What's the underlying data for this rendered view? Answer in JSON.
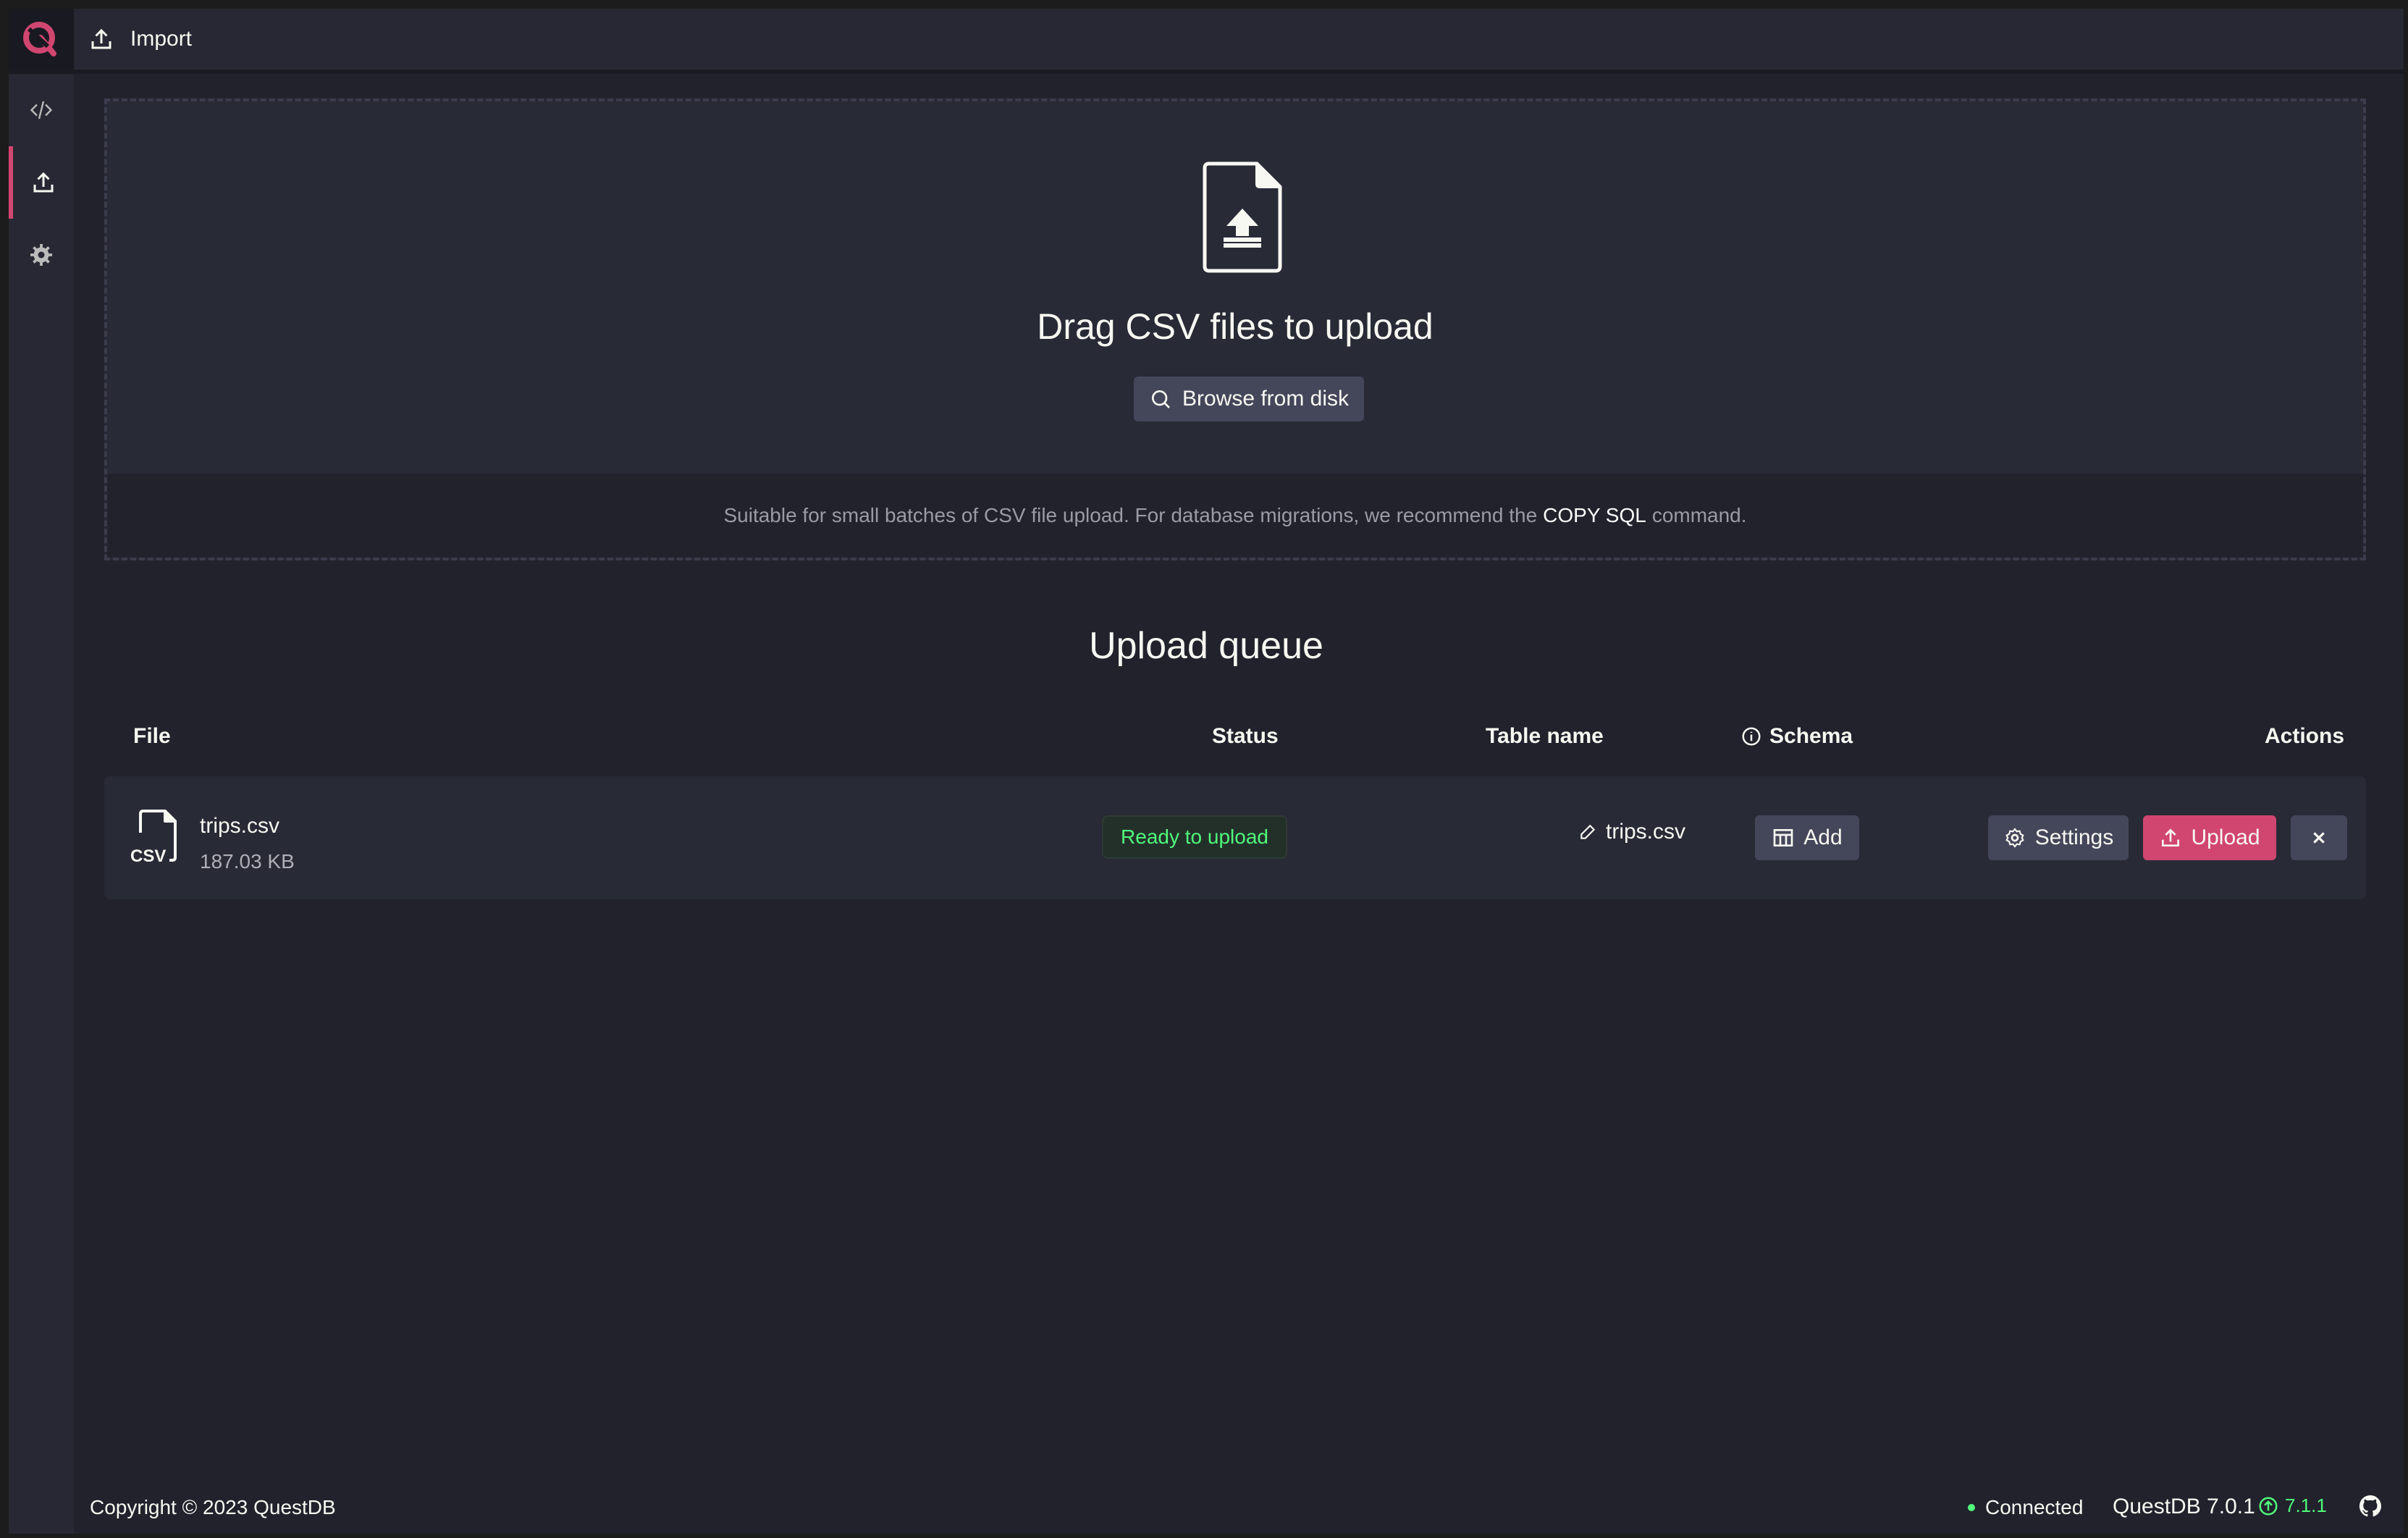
{
  "header": {
    "title": "Import"
  },
  "sidebar": {
    "items": [
      {
        "name": "code",
        "icon": "code-icon"
      },
      {
        "name": "import",
        "icon": "upload-icon",
        "active": true
      },
      {
        "name": "settings",
        "icon": "gear-icon"
      }
    ]
  },
  "dropzone": {
    "heading": "Drag CSV files to upload",
    "browse_label": "Browse from disk",
    "note_prefix": "Suitable for small batches of CSV file upload. For database migrations, we recommend the",
    "note_link": "COPY SQL",
    "note_suffix": "command."
  },
  "queue": {
    "title": "Upload queue",
    "columns": {
      "file": "File",
      "status": "Status",
      "table_name": "Table name",
      "schema": "Schema",
      "actions": "Actions"
    },
    "rows": [
      {
        "file_name": "trips.csv",
        "file_size": "187.03 KB",
        "file_type": "CSV",
        "status": "Ready to upload",
        "table_name": "trips.csv",
        "schema_action": "Add",
        "settings_label": "Settings",
        "upload_label": "Upload"
      }
    ]
  },
  "footer": {
    "copyright": "Copyright © 2023 QuestDB",
    "connection": "Connected",
    "version": "QuestDB 7.0.1",
    "update_version": "7.1.1"
  },
  "colors": {
    "accent": "#d14671",
    "success": "#50fa7b",
    "background": "#21222c"
  }
}
